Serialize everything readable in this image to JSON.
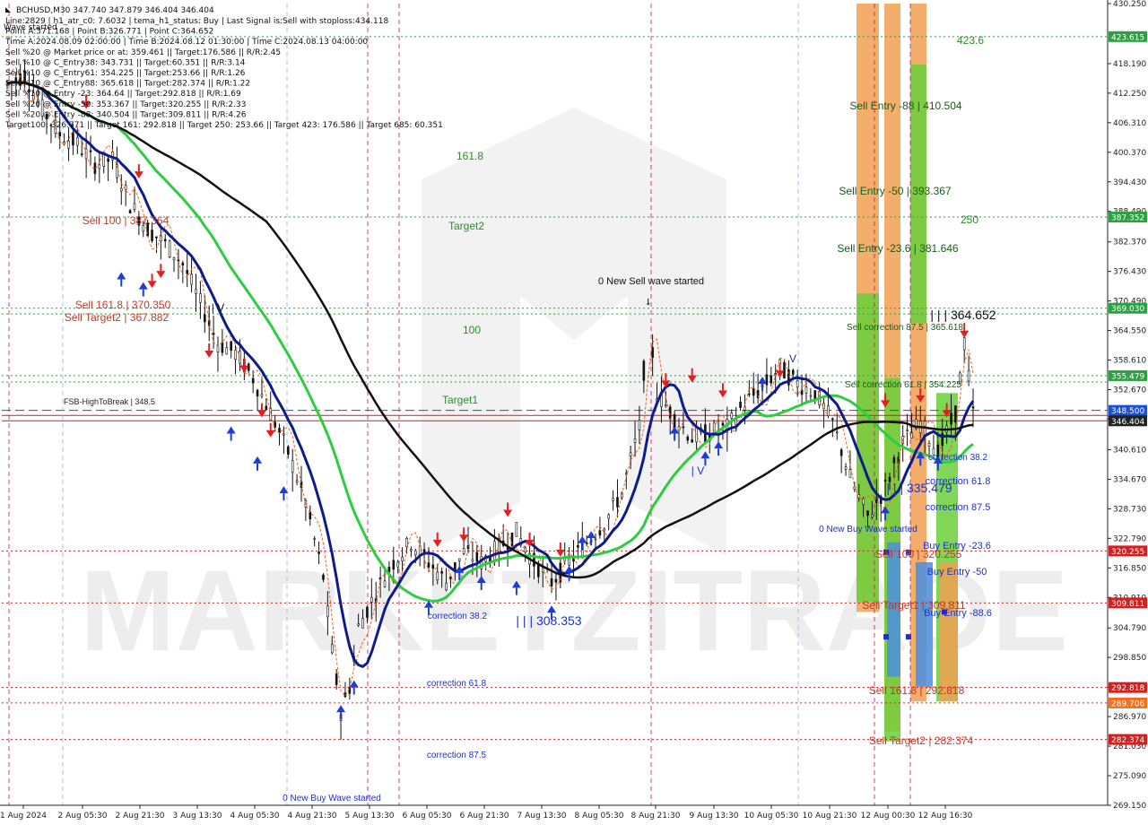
{
  "symbol_header": "BCHUSD,M30  347.740 347.879 346.404 346.404",
  "info_lines": [
    "Line:2829  | h1_atr_c0: 7.6032  | tema_h1_status: Buy  | Last Signal is:Sell with stoploss:434.118",
    "Point A:371.168  | Point B:326.771  | Point C:364.652",
    "Time A:2024.08.09 02:00:00  | Time B:2024.08.12 01:30:00  | Time C:2024.08.13 04:00:00",
    "Sell %20 @ Market price or at: 359.461  || Target:176.586  || R/R:2.45",
    "Sell %10 @ C_Entry38: 343.731  || Target:60.351  || R/R:3.14",
    "Sell %10 @ C_Entry61: 354.225  || Target:253.66  || R/R:1.26",
    "Sell %10 @ C_Entry88: 365.618  || Target:282.374  || R/R:1.22",
    "Sell %10 @ Entry -23: 364.64  || Target:292.818  || R/R:1.69",
    "Sell %20 @ Entry -50: 353.367  || Target:320.255  || R/R:2.33",
    "Sell %20 @ Entry -88: 340.504  || Target:309.811  || R/R:4.26",
    "Target100: 326.771  || Target 161: 292.818  || Target 250: 253.66  || Target 423: 176.586  || Target 685: 60.351"
  ],
  "wave_started_label": "Wave started",
  "watermark": "MARKETZITRADE",
  "chart_data": {
    "type": "candlestick",
    "symbol": "BCHUSD",
    "timeframe": "M30",
    "ohlc_header": {
      "open": 347.74,
      "high": 347.879,
      "low": 346.404,
      "close": 346.404
    },
    "y_axis": {
      "range": [
        269.15,
        430.25
      ],
      "ticks": [
        430.25,
        418.19,
        412.25,
        406.31,
        400.37,
        394.43,
        388.49,
        382.37,
        376.43,
        370.49,
        364.55,
        358.61,
        352.67,
        346.73,
        340.61,
        334.67,
        328.73,
        322.79,
        316.85,
        310.91,
        304.79,
        298.85,
        292.91,
        286.97,
        281.03,
        275.09,
        269.15
      ]
    },
    "x_axis": {
      "ticks": [
        "1 Aug 2024",
        "2 Aug 05:30",
        "2 Aug 21:30",
        "3 Aug 13:30",
        "4 Aug 05:30",
        "4 Aug 21:30",
        "5 Aug 13:30",
        "6 Aug 05:30",
        "6 Aug 21:30",
        "7 Aug 13:30",
        "8 Aug 05:30",
        "8 Aug 21:30",
        "9 Aug 13:30",
        "10 Aug 05:30",
        "10 Aug 21:30",
        "12 Aug 00:30",
        "12 Aug 16:30"
      ]
    },
    "price_boxes": [
      {
        "value": "423.615",
        "color": "#2ea043"
      },
      {
        "value": "387.352",
        "color": "#2ea043"
      },
      {
        "value": "369.030",
        "color": "#2ea043"
      },
      {
        "value": "355.479",
        "color": "#2ea043"
      },
      {
        "value": "348.500",
        "color": "#1f4fd1"
      },
      {
        "value": "346.404",
        "color": "#222222"
      },
      {
        "value": "320.255",
        "color": "#d02020"
      },
      {
        "value": "309.811",
        "color": "#d02020"
      },
      {
        "value": "292.818",
        "color": "#d02020"
      },
      {
        "value": "289.706",
        "color": "#f07020"
      },
      {
        "value": "282.374",
        "color": "#d02020"
      }
    ],
    "horizontal_lines": [
      {
        "price": 423.615,
        "color": "#2ea043",
        "style": "dotted"
      },
      {
        "price": 387.352,
        "color": "#2ea043",
        "style": "dotted"
      },
      {
        "price": 369.03,
        "color": "#2ea043",
        "style": "dotted"
      },
      {
        "price": 367.882,
        "color": "#2ea043",
        "style": "dotted"
      },
      {
        "price": 355.479,
        "color": "#2ea043",
        "style": "dotted"
      },
      {
        "price": 354.2,
        "color": "#2ea043",
        "style": "dotted"
      },
      {
        "price": 348.5,
        "color": "#1f4fd1",
        "style": "dashed"
      },
      {
        "price": 346.404,
        "color": "#d02020",
        "style": "solid"
      },
      {
        "price": 347.5,
        "color": "#d02020",
        "style": "solid"
      },
      {
        "price": 320.255,
        "color": "#d02020",
        "style": "dotted"
      },
      {
        "price": 309.811,
        "color": "#d02020",
        "style": "dotted"
      },
      {
        "price": 292.818,
        "color": "#d02020",
        "style": "dotted"
      },
      {
        "price": 289.706,
        "color": "#d02020",
        "style": "dotted"
      },
      {
        "price": 282.374,
        "color": "#d02020",
        "style": "dotted"
      }
    ],
    "annotations": [
      {
        "text": "423.6",
        "color": "#2e8b2e"
      },
      {
        "text": "161.8",
        "color": "#2e8b2e"
      },
      {
        "text": "250",
        "color": "#2e8b2e"
      },
      {
        "text": "Target2",
        "color": "#2e8b2e"
      },
      {
        "text": "100",
        "color": "#2e8b2e"
      },
      {
        "text": "Target1",
        "color": "#2e8b2e"
      },
      {
        "text": "Sell 100 | 387.364",
        "color": "#c0392b"
      },
      {
        "text": "Sell 161.8 | 370.350",
        "color": "#c0392b"
      },
      {
        "text": "Sell Target2 | 367.882",
        "color": "#c0392b"
      },
      {
        "text": "FSB-HighToBreak | 348.5",
        "color": "#222222"
      },
      {
        "text": "0 New Sell wave started",
        "color": "#111111"
      },
      {
        "text": "Sell Entry -88 | 410.504",
        "color": "#1a5c1a"
      },
      {
        "text": "Sell Entry -50 | 393.367",
        "color": "#1a5c1a"
      },
      {
        "text": "Sell Entry -23.6 | 381.646",
        "color": "#1a5c1a"
      },
      {
        "text": "Sell correction 87.5 | 365.618",
        "color": "#1a5c1a"
      },
      {
        "text": "Sell correction 61.8 | 354.225",
        "color": "#1a5c1a"
      },
      {
        "text": "| | | 364.652",
        "color": "#111111"
      },
      {
        "text": "correction 38.2",
        "color": "#1e2fd0"
      },
      {
        "text": "correction 61.8",
        "color": "#1e2fd0"
      },
      {
        "text": "correction 87.5",
        "color": "#1e2fd0"
      },
      {
        "text": "| | | 335.479",
        "color": "#1e2fd0"
      },
      {
        "text": "0 New Buy Wave started",
        "color": "#1e2fd0"
      },
      {
        "text": "Buy Entry -23.6",
        "color": "#1e2fd0"
      },
      {
        "text": "Buy Entry -50",
        "color": "#1e2fd0"
      },
      {
        "text": "Buy Entry -88.6",
        "color": "#1e2fd0"
      },
      {
        "text": "Sell 100 | 320.255",
        "color": "#c0392b"
      },
      {
        "text": "Sell Target1 | 309.811",
        "color": "#c0392b"
      },
      {
        "text": "Sell 161.8 | 292.818",
        "color": "#c0392b"
      },
      {
        "text": "Sell Target2 | 282.374",
        "color": "#c0392b"
      },
      {
        "text": "correction 38.2",
        "color": "#1e2fd0"
      },
      {
        "text": "| | | 308.353",
        "color": "#1e2fd0"
      },
      {
        "text": "correction 61.8",
        "color": "#1e2fd0"
      },
      {
        "text": "correction 87.5",
        "color": "#1e2fd0"
      },
      {
        "text": "0 New Buy Wave started",
        "color": "#1e2fd0"
      },
      {
        "text": "| V",
        "color": "#1e2fd0"
      },
      {
        "text": "V",
        "color": "#1e2fd0"
      },
      {
        "text": "| V",
        "color": "#111111"
      }
    ],
    "price_path": [
      {
        "t": 0,
        "p": 414
      },
      {
        "t": 4,
        "p": 416
      },
      {
        "t": 8,
        "p": 409
      },
      {
        "t": 12,
        "p": 404
      },
      {
        "t": 16,
        "p": 402
      },
      {
        "t": 20,
        "p": 398
      },
      {
        "t": 24,
        "p": 399
      },
      {
        "t": 28,
        "p": 390
      },
      {
        "t": 32,
        "p": 385
      },
      {
        "t": 36,
        "p": 382
      },
      {
        "t": 40,
        "p": 378
      },
      {
        "t": 44,
        "p": 370
      },
      {
        "t": 48,
        "p": 362
      },
      {
        "t": 52,
        "p": 360
      },
      {
        "t": 56,
        "p": 355
      },
      {
        "t": 60,
        "p": 348
      },
      {
        "t": 64,
        "p": 340
      },
      {
        "t": 68,
        "p": 330
      },
      {
        "t": 72,
        "p": 315
      },
      {
        "t": 74,
        "p": 300
      },
      {
        "t": 76,
        "p": 288
      },
      {
        "t": 78,
        "p": 293
      },
      {
        "t": 80,
        "p": 305
      },
      {
        "t": 84,
        "p": 312
      },
      {
        "t": 88,
        "p": 318
      },
      {
        "t": 92,
        "p": 322
      },
      {
        "t": 96,
        "p": 318
      },
      {
        "t": 100,
        "p": 314
      },
      {
        "t": 104,
        "p": 320
      },
      {
        "t": 108,
        "p": 318
      },
      {
        "t": 112,
        "p": 321
      },
      {
        "t": 116,
        "p": 324
      },
      {
        "t": 120,
        "p": 318
      },
      {
        "t": 124,
        "p": 314
      },
      {
        "t": 128,
        "p": 318
      },
      {
        "t": 132,
        "p": 322
      },
      {
        "t": 136,
        "p": 326
      },
      {
        "t": 140,
        "p": 332
      },
      {
        "t": 144,
        "p": 345
      },
      {
        "t": 146,
        "p": 368
      },
      {
        "t": 148,
        "p": 352
      },
      {
        "t": 152,
        "p": 347
      },
      {
        "t": 156,
        "p": 343
      },
      {
        "t": 160,
        "p": 344
      },
      {
        "t": 164,
        "p": 345
      },
      {
        "t": 168,
        "p": 350
      },
      {
        "t": 172,
        "p": 353
      },
      {
        "t": 176,
        "p": 357
      },
      {
        "t": 180,
        "p": 354
      },
      {
        "t": 184,
        "p": 352
      },
      {
        "t": 188,
        "p": 346
      },
      {
        "t": 192,
        "p": 335
      },
      {
        "t": 196,
        "p": 327
      },
      {
        "t": 200,
        "p": 333
      },
      {
        "t": 204,
        "p": 342
      },
      {
        "t": 208,
        "p": 346
      },
      {
        "t": 212,
        "p": 340
      },
      {
        "t": 216,
        "p": 348
      },
      {
        "t": 218,
        "p": 362
      },
      {
        "t": 220,
        "p": 348
      }
    ]
  }
}
